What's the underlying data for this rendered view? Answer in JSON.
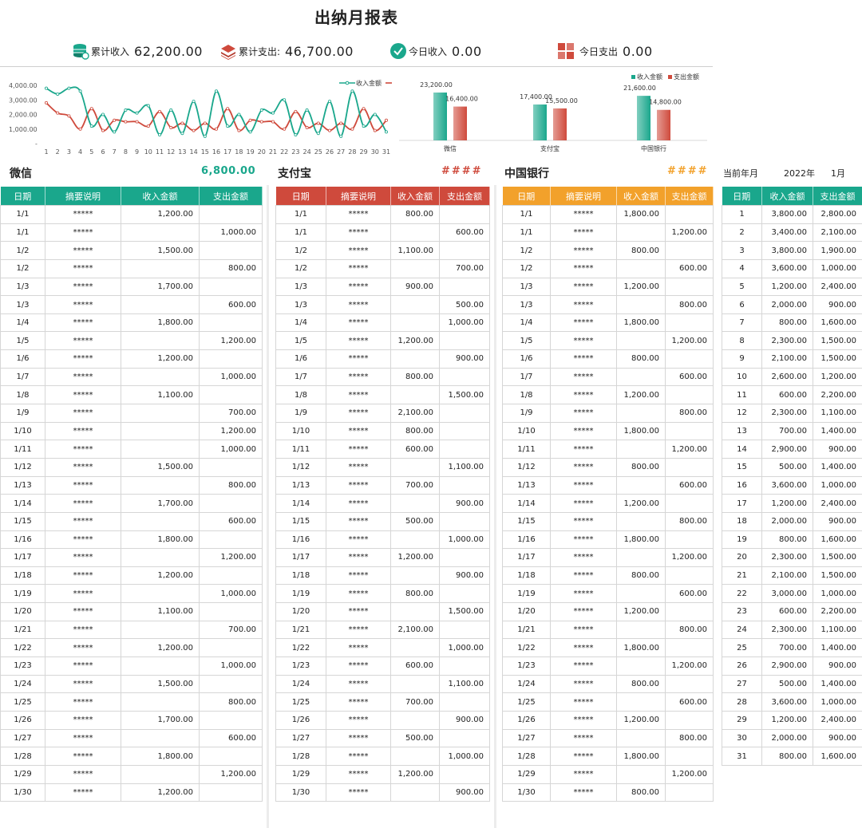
{
  "title": "出纳月报表",
  "kpis": {
    "income_label": "累计收入",
    "income_value": "62,200.00",
    "expense_label": "累计支出:",
    "expense_value": "46,700.00",
    "today_income_label": "今日收入",
    "today_income_value": "0.00",
    "today_expense_label": "今日支出",
    "today_expense_value": "0.00"
  },
  "colors": {
    "teal": "#1aa78c",
    "red": "#cf4a3c",
    "orange": "#f2a12b"
  },
  "chart_data": [
    {
      "type": "line",
      "x": [
        1,
        2,
        3,
        4,
        5,
        6,
        7,
        8,
        9,
        10,
        11,
        12,
        13,
        14,
        15,
        16,
        17,
        18,
        19,
        20,
        21,
        22,
        23,
        24,
        25,
        26,
        27,
        28,
        29,
        30,
        31
      ],
      "series": [
        {
          "name": "收入金额",
          "color": "#1aa78c",
          "values": [
            3800,
            3400,
            3800,
            3600,
            1200,
            2000,
            800,
            2300,
            2100,
            2600,
            600,
            2300,
            700,
            2900,
            500,
            3600,
            1200,
            2000,
            800,
            2300,
            2100,
            3000,
            600,
            2300,
            700,
            2900,
            500,
            3600,
            1200,
            2000,
            800
          ]
        },
        {
          "name": "",
          "color": "#cf4a3c",
          "values": [
            2800,
            2100,
            1900,
            1000,
            2400,
            900,
            1600,
            1500,
            1500,
            1200,
            2200,
            1100,
            1400,
            900,
            1400,
            1000,
            2400,
            900,
            1600,
            1500,
            1500,
            1000,
            2200,
            1100,
            1400,
            900,
            1400,
            1000,
            2400,
            900,
            1600
          ]
        }
      ],
      "yticks": [
        "4,000.00",
        "3,000.00",
        "2,000.00",
        "1,000.00",
        "-"
      ],
      "ylim": [
        0,
        4000
      ],
      "legend": "top-right"
    },
    {
      "type": "bar",
      "categories": [
        "微信",
        "支付宝",
        "中国银行"
      ],
      "series": [
        {
          "name": "收入金额",
          "color": "#1aa78c",
          "values": [
            23200,
            17400,
            21600
          ]
        },
        {
          "name": "支出金额",
          "color": "#cf4a3c",
          "values": [
            16400,
            15500,
            14800
          ]
        }
      ],
      "value_labels": [
        [
          "23,200.00",
          "16,400.00"
        ],
        [
          "17,400.00",
          "15,500.00"
        ],
        [
          "21,600.00",
          "14,800.00"
        ]
      ],
      "legend": "top-right"
    }
  ],
  "sections": {
    "wechat": {
      "title": "微信",
      "value": "6,800.00"
    },
    "alipay": {
      "title": "支付宝",
      "value": "####"
    },
    "boc": {
      "title": "中国银行",
      "value": "####"
    },
    "period": {
      "label": "当前年月",
      "year": "2022年",
      "month": "1月"
    }
  },
  "headers": {
    "date": "日期",
    "desc": "摘要说明",
    "income": "收入金额",
    "expense": "支出金额"
  },
  "wechat_rows": [
    [
      "1/1",
      "*****",
      "1,200.00",
      ""
    ],
    [
      "1/1",
      "*****",
      "",
      "1,000.00"
    ],
    [
      "1/2",
      "*****",
      "1,500.00",
      ""
    ],
    [
      "1/2",
      "*****",
      "",
      "800.00"
    ],
    [
      "1/3",
      "*****",
      "1,700.00",
      ""
    ],
    [
      "1/3",
      "*****",
      "",
      "600.00"
    ],
    [
      "1/4",
      "*****",
      "1,800.00",
      ""
    ],
    [
      "1/5",
      "*****",
      "",
      "1,200.00"
    ],
    [
      "1/6",
      "*****",
      "1,200.00",
      ""
    ],
    [
      "1/7",
      "*****",
      "",
      "1,000.00"
    ],
    [
      "1/8",
      "*****",
      "1,100.00",
      ""
    ],
    [
      "1/9",
      "*****",
      "",
      "700.00"
    ],
    [
      "1/10",
      "*****",
      "",
      "1,200.00"
    ],
    [
      "1/11",
      "*****",
      "",
      "1,000.00"
    ],
    [
      "1/12",
      "*****",
      "1,500.00",
      ""
    ],
    [
      "1/13",
      "*****",
      "",
      "800.00"
    ],
    [
      "1/14",
      "*****",
      "1,700.00",
      ""
    ],
    [
      "1/15",
      "*****",
      "",
      "600.00"
    ],
    [
      "1/16",
      "*****",
      "1,800.00",
      ""
    ],
    [
      "1/17",
      "*****",
      "",
      "1,200.00"
    ],
    [
      "1/18",
      "*****",
      "1,200.00",
      ""
    ],
    [
      "1/19",
      "*****",
      "",
      "1,000.00"
    ],
    [
      "1/20",
      "*****",
      "1,100.00",
      ""
    ],
    [
      "1/21",
      "*****",
      "",
      "700.00"
    ],
    [
      "1/22",
      "*****",
      "1,200.00",
      ""
    ],
    [
      "1/23",
      "*****",
      "",
      "1,000.00"
    ],
    [
      "1/24",
      "*****",
      "1,500.00",
      ""
    ],
    [
      "1/25",
      "*****",
      "",
      "800.00"
    ],
    [
      "1/26",
      "*****",
      "1,700.00",
      ""
    ],
    [
      "1/27",
      "*****",
      "",
      "600.00"
    ],
    [
      "1/28",
      "*****",
      "1,800.00",
      ""
    ],
    [
      "1/29",
      "*****",
      "",
      "1,200.00"
    ],
    [
      "1/30",
      "*****",
      "1,200.00",
      ""
    ]
  ],
  "alipay_rows": [
    [
      "1/1",
      "*****",
      "800.00",
      ""
    ],
    [
      "1/1",
      "*****",
      "",
      "600.00"
    ],
    [
      "1/2",
      "*****",
      "1,100.00",
      ""
    ],
    [
      "1/2",
      "*****",
      "",
      "700.00"
    ],
    [
      "1/3",
      "*****",
      "900.00",
      ""
    ],
    [
      "1/3",
      "*****",
      "",
      "500.00"
    ],
    [
      "1/4",
      "*****",
      "",
      "1,000.00"
    ],
    [
      "1/5",
      "*****",
      "1,200.00",
      ""
    ],
    [
      "1/6",
      "*****",
      "",
      "900.00"
    ],
    [
      "1/7",
      "*****",
      "800.00",
      ""
    ],
    [
      "1/8",
      "*****",
      "",
      "1,500.00"
    ],
    [
      "1/9",
      "*****",
      "2,100.00",
      ""
    ],
    [
      "1/10",
      "*****",
      "800.00",
      ""
    ],
    [
      "1/11",
      "*****",
      "600.00",
      ""
    ],
    [
      "1/12",
      "*****",
      "",
      "1,100.00"
    ],
    [
      "1/13",
      "*****",
      "700.00",
      ""
    ],
    [
      "1/14",
      "*****",
      "",
      "900.00"
    ],
    [
      "1/15",
      "*****",
      "500.00",
      ""
    ],
    [
      "1/16",
      "*****",
      "",
      "1,000.00"
    ],
    [
      "1/17",
      "*****",
      "1,200.00",
      ""
    ],
    [
      "1/18",
      "*****",
      "",
      "900.00"
    ],
    [
      "1/19",
      "*****",
      "800.00",
      ""
    ],
    [
      "1/20",
      "*****",
      "",
      "1,500.00"
    ],
    [
      "1/21",
      "*****",
      "2,100.00",
      ""
    ],
    [
      "1/22",
      "*****",
      "",
      "1,000.00"
    ],
    [
      "1/23",
      "*****",
      "600.00",
      ""
    ],
    [
      "1/24",
      "*****",
      "",
      "1,100.00"
    ],
    [
      "1/25",
      "*****",
      "700.00",
      ""
    ],
    [
      "1/26",
      "*****",
      "",
      "900.00"
    ],
    [
      "1/27",
      "*****",
      "500.00",
      ""
    ],
    [
      "1/28",
      "*****",
      "",
      "1,000.00"
    ],
    [
      "1/29",
      "*****",
      "1,200.00",
      ""
    ],
    [
      "1/30",
      "*****",
      "",
      "900.00"
    ]
  ],
  "boc_rows": [
    [
      "1/1",
      "*****",
      "1,800.00",
      ""
    ],
    [
      "1/1",
      "*****",
      "",
      "1,200.00"
    ],
    [
      "1/2",
      "*****",
      "800.00",
      ""
    ],
    [
      "1/2",
      "*****",
      "",
      "600.00"
    ],
    [
      "1/3",
      "*****",
      "1,200.00",
      ""
    ],
    [
      "1/3",
      "*****",
      "",
      "800.00"
    ],
    [
      "1/4",
      "*****",
      "1,800.00",
      ""
    ],
    [
      "1/5",
      "*****",
      "",
      "1,200.00"
    ],
    [
      "1/6",
      "*****",
      "800.00",
      ""
    ],
    [
      "1/7",
      "*****",
      "",
      "600.00"
    ],
    [
      "1/8",
      "*****",
      "1,200.00",
      ""
    ],
    [
      "1/9",
      "*****",
      "",
      "800.00"
    ],
    [
      "1/10",
      "*****",
      "1,800.00",
      ""
    ],
    [
      "1/11",
      "*****",
      "",
      "1,200.00"
    ],
    [
      "1/12",
      "*****",
      "800.00",
      ""
    ],
    [
      "1/13",
      "*****",
      "",
      "600.00"
    ],
    [
      "1/14",
      "*****",
      "1,200.00",
      ""
    ],
    [
      "1/15",
      "*****",
      "",
      "800.00"
    ],
    [
      "1/16",
      "*****",
      "1,800.00",
      ""
    ],
    [
      "1/17",
      "*****",
      "",
      "1,200.00"
    ],
    [
      "1/18",
      "*****",
      "800.00",
      ""
    ],
    [
      "1/19",
      "*****",
      "",
      "600.00"
    ],
    [
      "1/20",
      "*****",
      "1,200.00",
      ""
    ],
    [
      "1/21",
      "*****",
      "",
      "800.00"
    ],
    [
      "1/22",
      "*****",
      "1,800.00",
      ""
    ],
    [
      "1/23",
      "*****",
      "",
      "1,200.00"
    ],
    [
      "1/24",
      "*****",
      "800.00",
      ""
    ],
    [
      "1/25",
      "*****",
      "",
      "600.00"
    ],
    [
      "1/26",
      "*****",
      "1,200.00",
      ""
    ],
    [
      "1/27",
      "*****",
      "",
      "800.00"
    ],
    [
      "1/28",
      "*****",
      "1,800.00",
      ""
    ],
    [
      "1/29",
      "*****",
      "",
      "1,200.00"
    ],
    [
      "1/30",
      "*****",
      "800.00",
      ""
    ]
  ],
  "daily_rows": [
    [
      "1",
      "3,800.00",
      "2,800.00"
    ],
    [
      "2",
      "3,400.00",
      "2,100.00"
    ],
    [
      "3",
      "3,800.00",
      "1,900.00"
    ],
    [
      "4",
      "3,600.00",
      "1,000.00"
    ],
    [
      "5",
      "1,200.00",
      "2,400.00"
    ],
    [
      "6",
      "2,000.00",
      "900.00"
    ],
    [
      "7",
      "800.00",
      "1,600.00"
    ],
    [
      "8",
      "2,300.00",
      "1,500.00"
    ],
    [
      "9",
      "2,100.00",
      "1,500.00"
    ],
    [
      "10",
      "2,600.00",
      "1,200.00"
    ],
    [
      "11",
      "600.00",
      "2,200.00"
    ],
    [
      "12",
      "2,300.00",
      "1,100.00"
    ],
    [
      "13",
      "700.00",
      "1,400.00"
    ],
    [
      "14",
      "2,900.00",
      "900.00"
    ],
    [
      "15",
      "500.00",
      "1,400.00"
    ],
    [
      "16",
      "3,600.00",
      "1,000.00"
    ],
    [
      "17",
      "1,200.00",
      "2,400.00"
    ],
    [
      "18",
      "2,000.00",
      "900.00"
    ],
    [
      "19",
      "800.00",
      "1,600.00"
    ],
    [
      "20",
      "2,300.00",
      "1,500.00"
    ],
    [
      "21",
      "2,100.00",
      "1,500.00"
    ],
    [
      "22",
      "3,000.00",
      "1,000.00"
    ],
    [
      "23",
      "600.00",
      "2,200.00"
    ],
    [
      "24",
      "2,300.00",
      "1,100.00"
    ],
    [
      "25",
      "700.00",
      "1,400.00"
    ],
    [
      "26",
      "2,900.00",
      "900.00"
    ],
    [
      "27",
      "500.00",
      "1,400.00"
    ],
    [
      "28",
      "3,600.00",
      "1,000.00"
    ],
    [
      "29",
      "1,200.00",
      "2,400.00"
    ],
    [
      "30",
      "2,000.00",
      "900.00"
    ],
    [
      "31",
      "800.00",
      "1,600.00"
    ]
  ]
}
